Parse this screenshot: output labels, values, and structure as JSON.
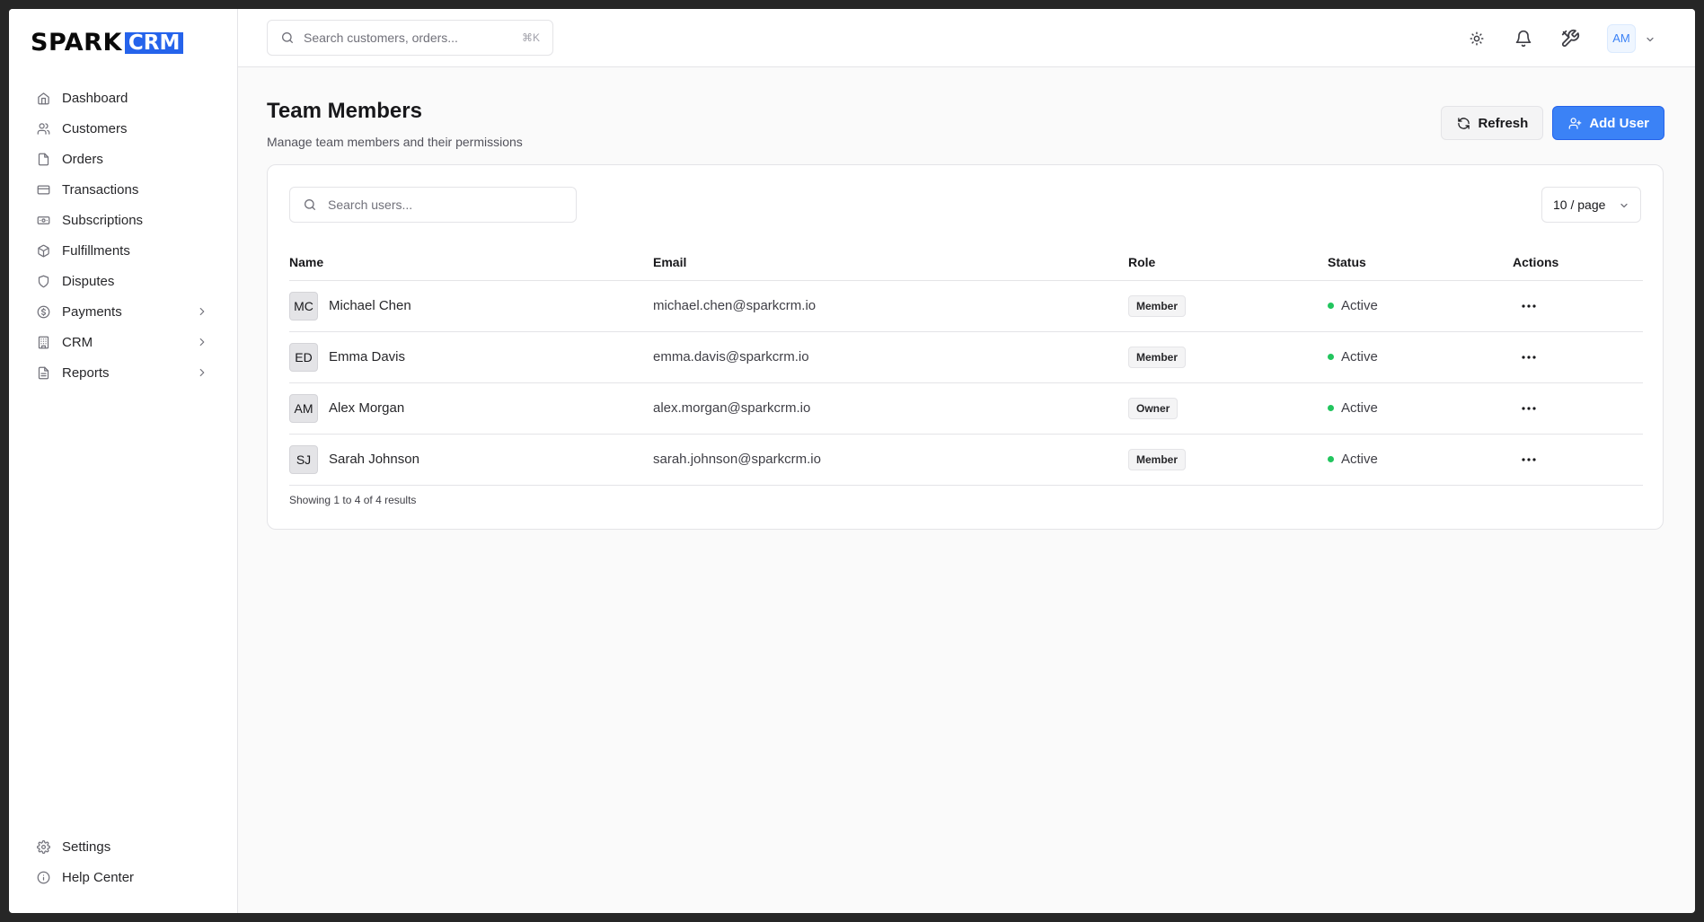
{
  "brand": {
    "name_left": "SPARK",
    "name_right": "CRM",
    "accent": "#2563eb"
  },
  "sidebar": {
    "items": [
      {
        "label": "Dashboard",
        "icon": "home-icon"
      },
      {
        "label": "Customers",
        "icon": "users-icon"
      },
      {
        "label": "Orders",
        "icon": "file-icon"
      },
      {
        "label": "Transactions",
        "icon": "credit-card-icon"
      },
      {
        "label": "Subscriptions",
        "icon": "banknote-icon"
      },
      {
        "label": "Fulfillments",
        "icon": "package-icon"
      },
      {
        "label": "Disputes",
        "icon": "shield-icon"
      },
      {
        "label": "Payments",
        "icon": "dollar-circle-icon",
        "expandable": true
      },
      {
        "label": "CRM",
        "icon": "building-icon",
        "expandable": true
      },
      {
        "label": "Reports",
        "icon": "file-text-icon",
        "expandable": true
      }
    ],
    "bottom": [
      {
        "label": "Settings",
        "icon": "gear-icon"
      },
      {
        "label": "Help Center",
        "icon": "info-icon"
      }
    ]
  },
  "topbar": {
    "search_placeholder": "Search customers, orders...",
    "shortcut": "⌘K",
    "user_initials": "AM"
  },
  "page": {
    "title": "Team Members",
    "subtitle": "Manage team members and their permissions",
    "refresh_label": "Refresh",
    "add_user_label": "Add User"
  },
  "table": {
    "search_placeholder": "Search users...",
    "page_size": "10 / page",
    "columns": [
      "Name",
      "Email",
      "Role",
      "Status",
      "Actions"
    ],
    "rows": [
      {
        "initials": "MC",
        "name": "Michael Chen",
        "email": "michael.chen@sparkcrm.io",
        "role": "Member",
        "status": "Active"
      },
      {
        "initials": "ED",
        "name": "Emma Davis",
        "email": "emma.davis@sparkcrm.io",
        "role": "Member",
        "status": "Active"
      },
      {
        "initials": "AM",
        "name": "Alex Morgan",
        "email": "alex.morgan@sparkcrm.io",
        "role": "Owner",
        "status": "Active"
      },
      {
        "initials": "SJ",
        "name": "Sarah Johnson",
        "email": "sarah.johnson@sparkcrm.io",
        "role": "Member",
        "status": "Active"
      }
    ],
    "results_text": "Showing 1 to 4 of 4 results",
    "status_color": "#22c55e"
  }
}
